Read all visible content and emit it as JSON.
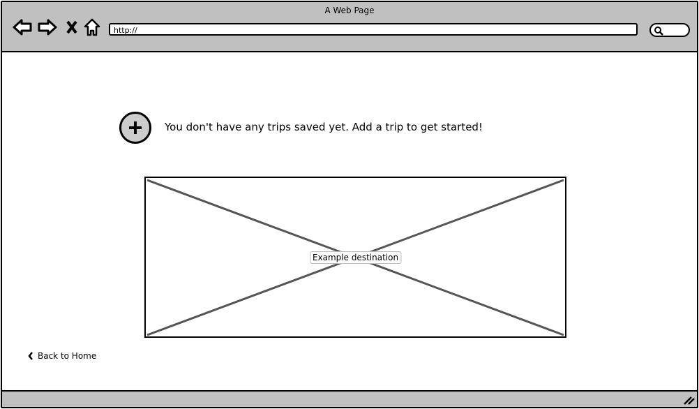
{
  "browser": {
    "title": "A Web Page",
    "url": "http://",
    "icons": [
      "back-arrow-icon",
      "forward-arrow-icon",
      "close-icon",
      "home-icon",
      "search-icon",
      "resize-handle-icon"
    ]
  },
  "main": {
    "empty_message": "You don't have any trips saved yet. Add a trip to get started!",
    "add_icon": "plus-icon",
    "image_caption": "Example destination",
    "back_link": "Back to Home",
    "back_icon": "chevron-left-icon"
  },
  "colors": {
    "chrome": "#c0c0c0",
    "button": "#cccccc",
    "placeholder_lines": "#555555"
  }
}
